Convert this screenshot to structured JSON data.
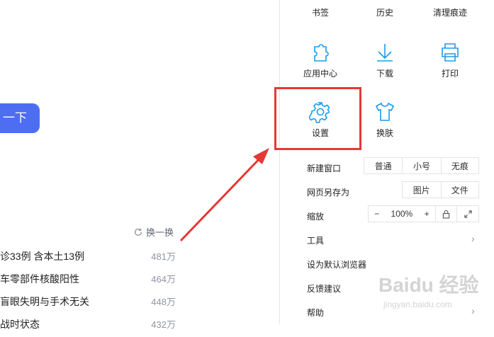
{
  "search": {
    "button_label": "一下"
  },
  "hot": {
    "refresh_label": "换一换",
    "items": [
      {
        "title": "诊33例 含本土13例",
        "count": "481万"
      },
      {
        "title": "车零部件核酸阳性",
        "count": "464万"
      },
      {
        "title": "盲眼失明与手术无关",
        "count": "448万"
      },
      {
        "title": "战时状态",
        "count": "432万"
      }
    ]
  },
  "menu": {
    "tiles": [
      {
        "label": "书签",
        "icon": "bookmark-icon"
      },
      {
        "label": "历史",
        "icon": "history-icon"
      },
      {
        "label": "清理痕迹",
        "icon": "clear-traces-icon"
      },
      {
        "label": "应用中心",
        "icon": "puzzle-icon"
      },
      {
        "label": "下载",
        "icon": "download-icon"
      },
      {
        "label": "打印",
        "icon": "printer-icon"
      },
      {
        "label": "设置",
        "icon": "gear-icon"
      },
      {
        "label": "换肤",
        "icon": "shirt-icon"
      }
    ],
    "new_window": {
      "label": "新建窗口",
      "options": [
        "普通",
        "小号",
        "无痕"
      ]
    },
    "save_as": {
      "label": "网页另存为",
      "options": [
        "图片",
        "文件"
      ]
    },
    "zoom": {
      "label": "缩放",
      "minus": "−",
      "value": "100%",
      "plus": "+"
    },
    "tools_label": "工具",
    "default_browser_label": "设为默认浏览器",
    "feedback_label": "反馈建议",
    "help_label": "帮助"
  },
  "watermark": {
    "logo": "Baidu 经验",
    "url": "jingyan.baidu.com"
  },
  "colors": {
    "accent": "#1e9ae8",
    "search_button": "#4e6ef2",
    "highlight": "#e53935"
  }
}
